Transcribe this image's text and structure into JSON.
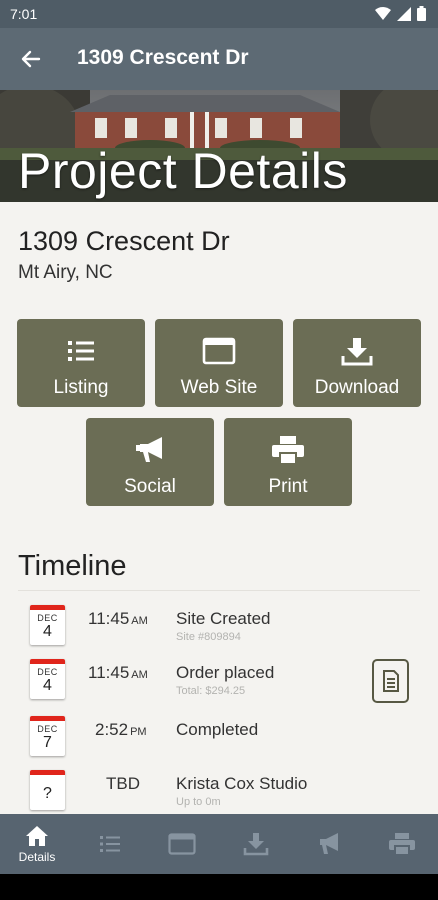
{
  "status_bar": {
    "time": "7:01"
  },
  "app_bar": {
    "title": "1309 Crescent Dr"
  },
  "hero": {
    "title": "Project Details"
  },
  "address": {
    "line1": "1309 Crescent Dr",
    "line2": "Mt Airy, NC"
  },
  "actions": {
    "listing": "Listing",
    "website": "Web Site",
    "download": "Download",
    "social": "Social",
    "print": "Print"
  },
  "timeline": {
    "heading": "Timeline",
    "items": [
      {
        "month": "DEC",
        "day": "4",
        "time": "11:45",
        "ampm": "AM",
        "title": "Site Created",
        "sub": "Site #809894"
      },
      {
        "month": "DEC",
        "day": "4",
        "time": "11:45",
        "ampm": "AM",
        "title": "Order placed",
        "sub": "Total: $294.25"
      },
      {
        "month": "DEC",
        "day": "7",
        "time": "2:52",
        "ampm": "PM",
        "title": "Completed",
        "sub": ""
      },
      {
        "month": "",
        "day": "?",
        "time": "TBD",
        "ampm": "",
        "title": "Krista Cox Studio",
        "sub": "Up to 0m"
      }
    ]
  },
  "bottom_nav": {
    "details": "Details"
  },
  "colors": {
    "tile": "#6b6d55",
    "app_bar": "#5d6a74",
    "nav_bar": "#576470",
    "calendar_red": "#e0251b"
  }
}
